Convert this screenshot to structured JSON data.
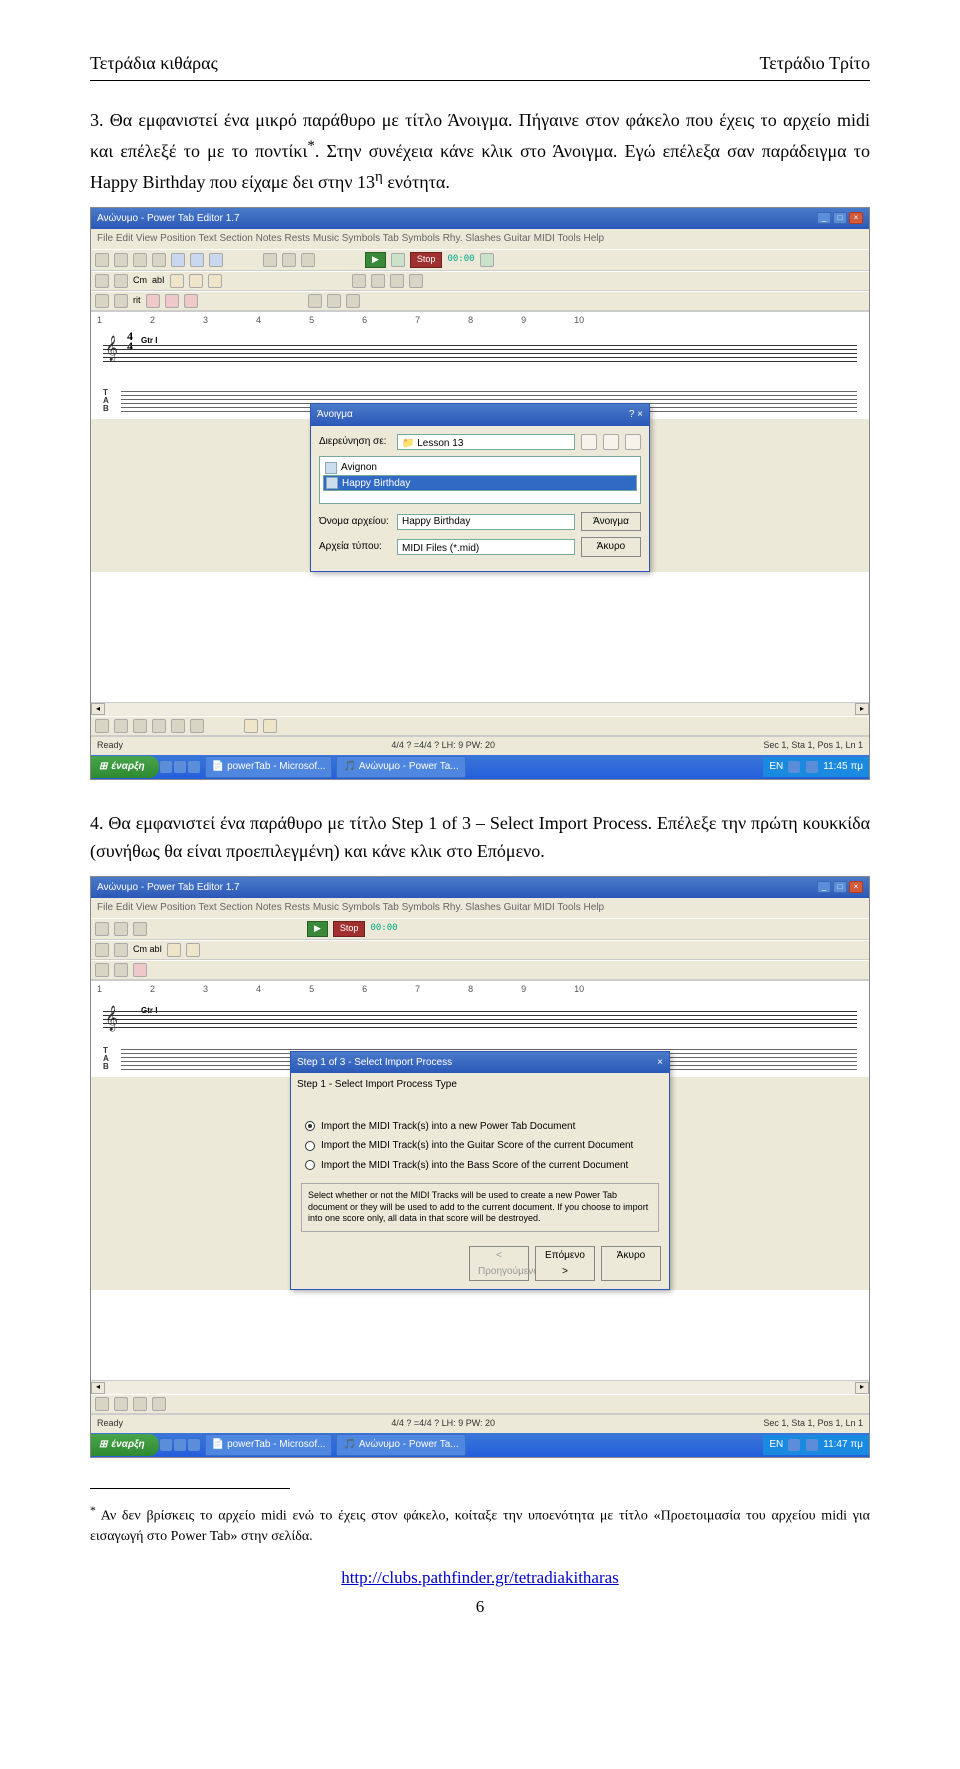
{
  "header": {
    "left": "Τετράδια κιθάρας",
    "right": "Τετράδιο Τρίτο"
  },
  "para1_a": "3. Θα εμφανιστεί ένα μικρό παράθυρο με τίτλο Άνοιγμα. Πήγαινε στον φάκελο που έχεις το αρχείο midi και επέλεξέ το με το ποντίκι",
  "para1_star": "*",
  "para1_b": ". Στην συνέχεια κάνε κλικ στο Άνοιγμα. Εγώ επέλεξα σαν παράδειγμα το Happy Birthday που είχαμε δει στην 13",
  "para1_sup": "η",
  "para1_c": " ενότητα.",
  "app": {
    "title": "Ανώνυμο - Power Tab Editor 1.7",
    "menu": "File   Edit   View   Position   Text   Section   Notes   Rests   Music Symbols   Tab Symbols   Rhy. Slashes   Guitar   MIDI   Tools   Help",
    "time": "00:00",
    "ruler": [
      "1",
      "2",
      "3",
      "4",
      "5",
      "6",
      "7",
      "8",
      "9",
      "10"
    ],
    "gtr": "Gtr I",
    "status_left": "Ready",
    "status_mid": "4/4     ?     =4/4     ?     LH: 9   PW: 20",
    "status_right1": "Sec 1, Sta 1, Pos 1, Ln 1",
    "status_right2": "Sec 1, Sta 1, Pos 1, Ln 1"
  },
  "open_dialog": {
    "title": "Άνοιγμα",
    "look_label": "Διερεύνηση σε:",
    "folder": "Lesson 13",
    "item1": "Avignon",
    "item2": "Happy Birthday",
    "name_label": "Όνομα αρχείου:",
    "name_value": "Happy Birthday",
    "type_label": "Αρχεία τύπου:",
    "type_value": "MIDI Files (*.mid)",
    "open_btn": "Άνοιγμα",
    "cancel_btn": "Άκυρο"
  },
  "taskbar": {
    "start": "έναρξη",
    "task1": "powerTab - Microsof...",
    "task2": "Ανώνυμο - Power Ta...",
    "lang": "EN",
    "clock1": "11:45 πμ",
    "clock2": "11:47 πμ"
  },
  "para2": "4. Θα εμφανιστεί ένα παράθυρο με τίτλο Step 1 of 3 – Select Import Process. Επέλεξε την πρώτη κουκκίδα (συνήθως θα είναι προεπιλεγμένη) και κάνε κλικ στο Επόμενο.",
  "wizard": {
    "title": "Step 1 of 3 - Select Import Process",
    "group": "Step 1 - Select Import Process Type",
    "op1": "Import the MIDI Track(s) into a new Power Tab Document",
    "op2": "Import the MIDI Track(s) into the Guitar Score of the current Document",
    "op3": "Import the MIDI Track(s) into the Bass Score of the current Document",
    "hint": "Select whether or not the MIDI Tracks will be used to create a new Power Tab document or they will be used to add to the current document. If you choose to import into one score only, all data in that score will be destroyed.",
    "back": "< Προηγούμενο",
    "next": "Επόμενο >",
    "cancel": "Άκυρο"
  },
  "footnote_star": "*",
  "footnote": " Αν δεν βρίσκεις το αρχείο midi ενώ το έχεις στον φάκελο, κοίταξε την υποενότητα με τίτλο «Προετοιμασία του αρχείου midi για εισαγωγή στο Power Tab» στην σελίδα.",
  "footer_link": "http://clubs.pathfinder.gr/tetradiakitharas",
  "page_num": "6"
}
